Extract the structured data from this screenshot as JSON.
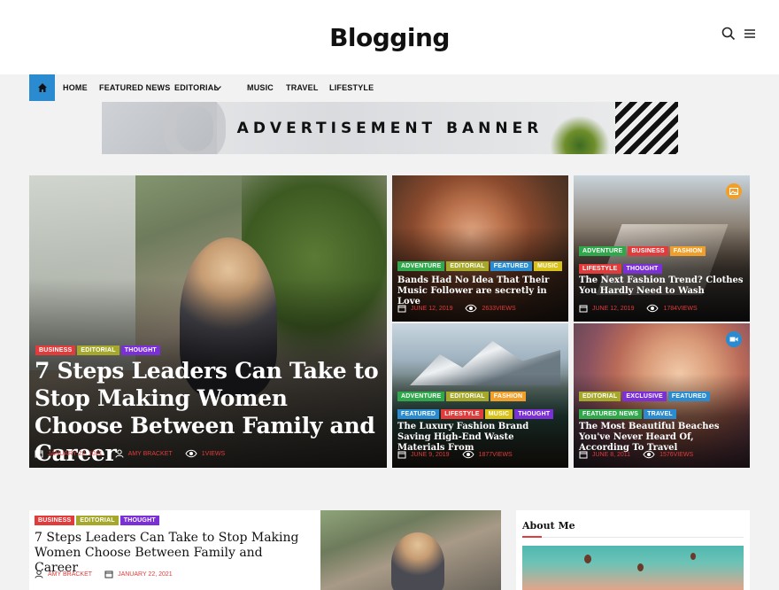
{
  "site": {
    "title": "Blogging"
  },
  "nav": {
    "items": [
      "HOME",
      "FEATURED NEWS",
      "EDITORIAL",
      "MUSIC",
      "TRAVEL",
      "LIFESTYLE"
    ]
  },
  "ad": {
    "text": "ADVERTISEMENT BANNER"
  },
  "colors": {
    "accent": "#2a8bd0",
    "date": "#e23b3b",
    "badge_red": "#e23b3b",
    "badge_olive": "#a6a82b",
    "badge_purple": "#7b2fd6",
    "badge_green": "#2ea84a",
    "badge_blue": "#2a8bd0",
    "badge_yellow": "#d8c21a",
    "badge_orange": "#f0a02a"
  },
  "featured": {
    "main": {
      "badges": [
        "BUSINESS",
        "EDITORIAL",
        "THOUGHT"
      ],
      "title": "7 Steps Leaders Can Take to Stop Making Women Choose Between Family and Career",
      "date": "JANUARY 22, 2021",
      "author": "AMY BRACKET",
      "views": "1VIEWS"
    },
    "tile1": {
      "badges": [
        "ADVENTURE",
        "EDITORIAL",
        "FEATURED",
        "MUSIC"
      ],
      "title": "Bands Had No Idea That Their Music Follower are secretly in Love",
      "date": "JUNE 12, 2019",
      "views": "2633VIEWS"
    },
    "tile2": {
      "badges": [
        "ADVENTURE",
        "BUSINESS",
        "FASHION",
        "LIFESTYLE",
        "THOUGHT"
      ],
      "title": "The Next Fashion Trend? Clothes You Hardly Need to Wash",
      "date": "JUNE 12, 2019",
      "views": "1784VIEWS"
    },
    "tile3": {
      "badges": [
        "ADVENTURE",
        "EDITORIAL",
        "FASHION",
        "FEATURED",
        "LIFESTYLE",
        "MUSIC",
        "THOUGHT"
      ],
      "title": "The Luxury Fashion Brand Saving High-End Waste Materials From",
      "date": "JUNE 9, 2019",
      "views": "1877VIEWS"
    },
    "tile4": {
      "badges": [
        "EDITORIAL",
        "EXCLUSIVE",
        "FEATURED",
        "FEATURED NEWS",
        "TRAVEL"
      ],
      "title": "The Most Beautiful Beaches You've Never Heard Of, According To Travel",
      "date": "JUNE 8, 2011",
      "views": "1576VIEWS"
    }
  },
  "post": {
    "badges": [
      "BUSINESS",
      "EDITORIAL",
      "THOUGHT"
    ],
    "title": "7 Steps Leaders Can Take to Stop Making Women Choose Between Family and Career",
    "author": "AMY BRACKET",
    "date": "JANUARY 22, 2021"
  },
  "sidebar": {
    "about_title": "About Me"
  }
}
